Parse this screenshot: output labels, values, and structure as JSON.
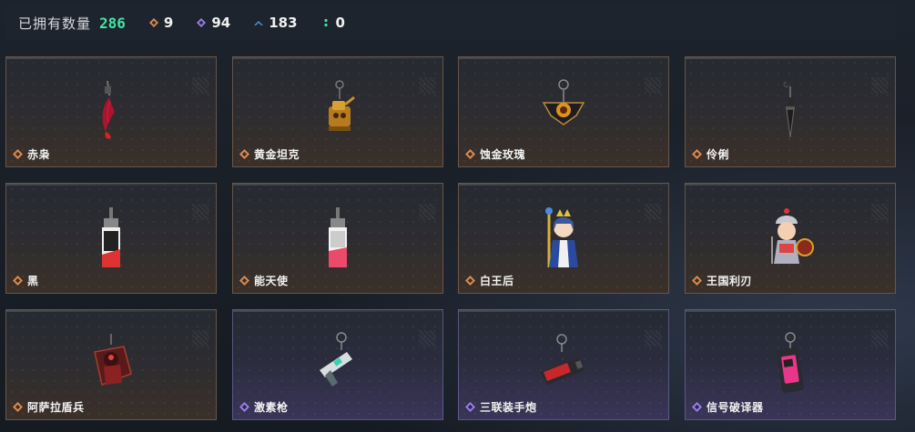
{
  "summary": {
    "owned_label": "已拥有数量",
    "owned_count": "286",
    "stats": [
      {
        "icon": "orange-diamond-icon",
        "color": "#e08a4a",
        "value": "9"
      },
      {
        "icon": "purple-diamond-icon",
        "color": "#9a7df0",
        "value": "94"
      },
      {
        "icon": "blue-chevron-icon",
        "color": "#4f94d8",
        "value": "183"
      },
      {
        "icon": "green-dot-icon",
        "color": "#3ee6a2",
        "value": "0"
      }
    ]
  },
  "items": [
    {
      "name": "赤枭",
      "rarity": "orange",
      "art": "crimson-blade-charm-icon"
    },
    {
      "name": "黄金坦克",
      "rarity": "orange",
      "art": "golden-tank-charm-icon"
    },
    {
      "name": "蚀金玫瑰",
      "rarity": "orange",
      "art": "eclipse-rose-charm-icon"
    },
    {
      "name": "伶俐",
      "rarity": "orange",
      "art": "dagger-charm-icon"
    },
    {
      "name": "黑",
      "rarity": "orange",
      "art": "black-card-charm-icon"
    },
    {
      "name": "能天使",
      "rarity": "orange",
      "art": "angel-card-charm-icon"
    },
    {
      "name": "白王后",
      "rarity": "orange",
      "art": "white-queen-charm-icon"
    },
    {
      "name": "王国利刃",
      "rarity": "orange",
      "art": "kingdom-blade-charm-icon"
    },
    {
      "name": "阿萨拉盾兵",
      "rarity": "orange",
      "art": "shield-soldier-charm-icon"
    },
    {
      "name": "激素枪",
      "rarity": "purple",
      "art": "hormone-gun-charm-icon"
    },
    {
      "name": "三联装手炮",
      "rarity": "purple",
      "art": "triple-hand-cannon-charm-icon"
    },
    {
      "name": "信号破译器",
      "rarity": "purple",
      "art": "signal-decoder-charm-icon"
    }
  ]
}
